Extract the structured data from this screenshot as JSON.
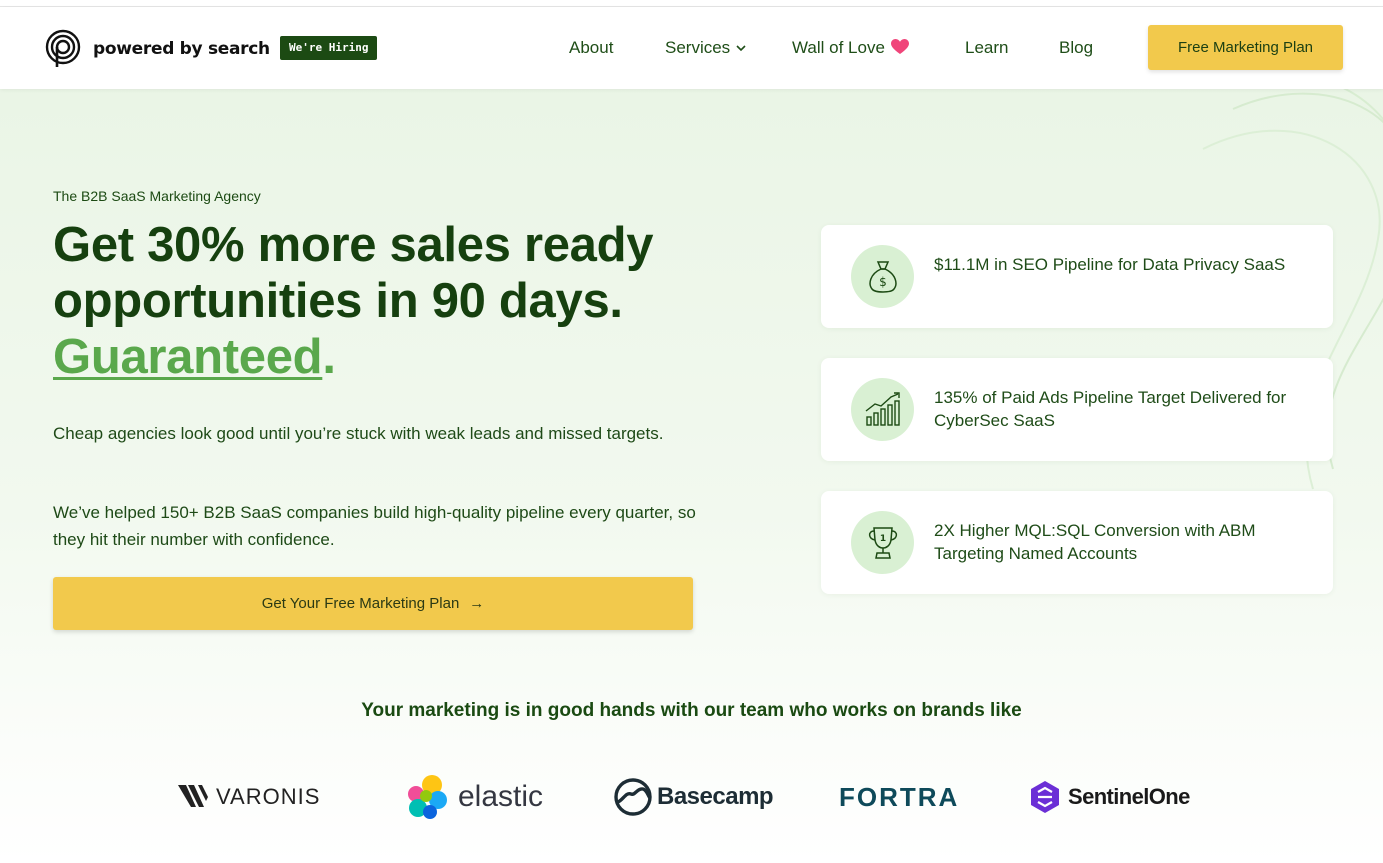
{
  "header": {
    "logo_text": "powered by search",
    "hiring_badge": "We're Hiring",
    "nav": {
      "about": "About",
      "services": "Services",
      "wall_of_love": "Wall of Love",
      "learn": "Learn",
      "blog": "Blog"
    },
    "cta": "Free Marketing Plan"
  },
  "hero": {
    "eyebrow": "The B2B SaaS Marketing Agency",
    "headline_line1": "Get 30% more sales ready",
    "headline_line2": "opportunities in 90 days.",
    "headline_emphasis": "Guaranteed",
    "headline_period": ".",
    "paragraph1": "Cheap agencies look good until you’re stuck with weak leads and missed targets.",
    "paragraph2": "We’ve helped 150+ B2B SaaS companies build high-quality pipeline every quarter, so they hit their number with confidence.",
    "cta": "Get Your Free Marketing Plan",
    "cta_arrow": "→"
  },
  "results": [
    {
      "icon": "money-bag-icon",
      "text": "$11.1M in SEO Pipeline for Data Privacy SaaS"
    },
    {
      "icon": "growth-chart-icon",
      "text": "135% of Paid Ads Pipeline Target Delivered for CyberSec SaaS"
    },
    {
      "icon": "trophy-icon",
      "text": "2X Higher MQL:SQL Conversion with ABM Targeting Named Accounts"
    }
  ],
  "brands": {
    "title": "Your marketing is in good hands with our team who works on brands like",
    "logos": [
      "VARONIS",
      "elastic",
      "Basecamp",
      "FORTRA",
      "SentinelOne"
    ]
  },
  "colors": {
    "brand_green_dark": "#16400f",
    "accent_green": "#5aa84c",
    "cta_yellow": "#f2c94c",
    "hero_bg": "#eaf5e6"
  }
}
